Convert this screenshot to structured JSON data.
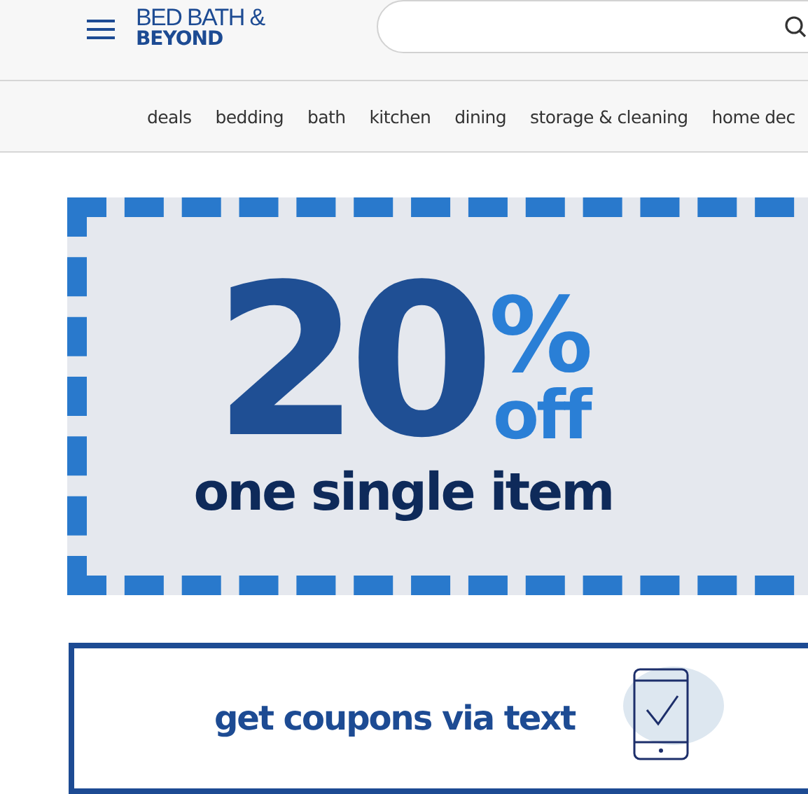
{
  "header": {
    "logo": {
      "line_1": "BED BATH &",
      "line_2": "BEYOND"
    }
  },
  "nav": {
    "items": [
      "deals",
      "bedding",
      "bath",
      "kitchen",
      "dining",
      "storage & cleaning",
      "home dec"
    ]
  },
  "coupon": {
    "amount": "20",
    "percent": "%",
    "off": "off",
    "subtitle": "one single item"
  },
  "text_banner": {
    "label": "get coupons via text"
  }
}
